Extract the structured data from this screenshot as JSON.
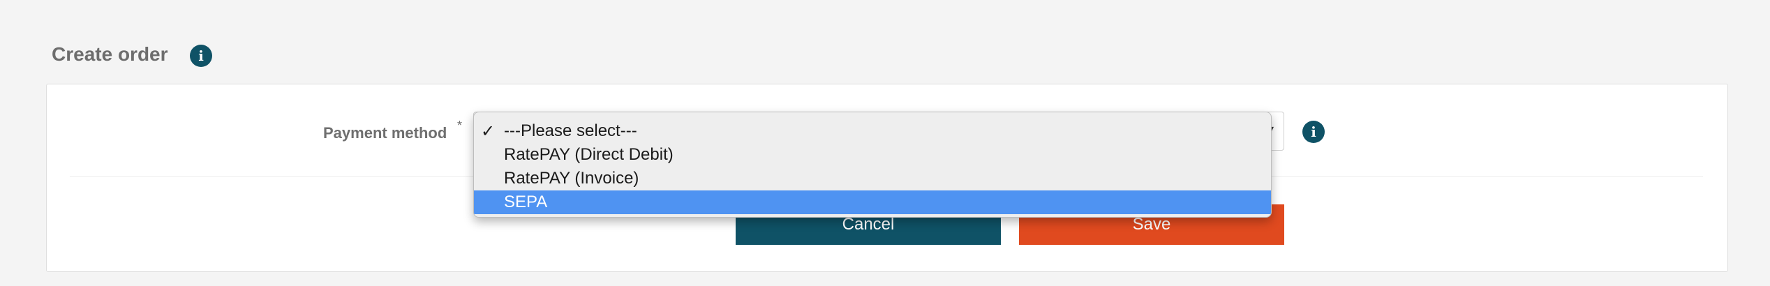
{
  "page": {
    "title": "Create order",
    "title_info_icon": "info-icon"
  },
  "form": {
    "payment_method": {
      "label": "Payment method",
      "required_mark": "*",
      "info_icon": "info-icon",
      "options": [
        "---Please select---",
        "RatePAY (Direct Debit)",
        "RatePAY (Invoice)",
        "SEPA"
      ],
      "checked_option": "---Please select---",
      "highlighted_option": "SEPA",
      "checkmark": "✓"
    }
  },
  "actions": {
    "cancel_label": "Cancel",
    "save_label": "Save"
  },
  "colors": {
    "accent_dark": "#0f5266",
    "save": "#e04a1f",
    "highlight": "#4f93f2"
  }
}
